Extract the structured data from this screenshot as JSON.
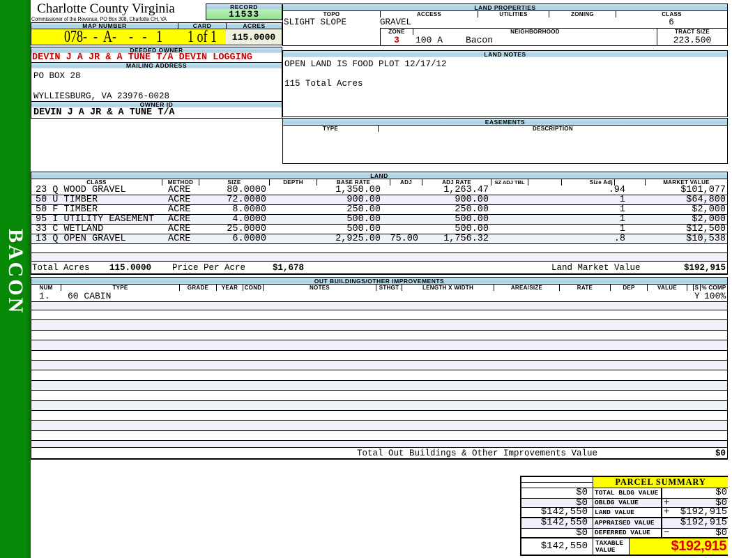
{
  "county": {
    "title": "Charlotte County Virginia",
    "subtitle": "Commissioner of the Revenue, PO Box 308, Charlotte CH, VA"
  },
  "sidebar": {
    "label": "BACON"
  },
  "record": {
    "label": "RECORD",
    "value": "11533"
  },
  "map": {
    "map_number_label": "MAP NUMBER",
    "map_number": "078-  -  A-    -   -   1",
    "card_label": "CARD",
    "card": "1 of 1",
    "acres_label": "ACRES",
    "acres": "115.0000"
  },
  "owner": {
    "deeded_owner_label": "DEEDED OWNER",
    "deeded_owner": "DEVIN J A JR & A TUNE T/A DEVIN LOGGING",
    "mailing_address_label": "MAILING ADDRESS",
    "address_line1": "PO BOX 28",
    "address_line2": "WYLLIESBURG, VA 23976-0028",
    "owner_id_label": "OWNER ID",
    "owner_id": "DEVIN J A JR & A TUNE T/A"
  },
  "land_properties": {
    "title": "LAND PROPERTIES",
    "topo_label": "TOPO",
    "access_label": "ACCESS",
    "utilities_label": "UTILITIES",
    "zoning_label": "ZONING",
    "class_label": "CLASS",
    "topo": "SLIGHT SLOPE",
    "access": "GRAVEL",
    "utilities": "",
    "zoning": "",
    "class": "6",
    "zone_label": "ZONE",
    "zone": "3",
    "neighborhood_label": "NEIGHBORHOOD",
    "neighborhood_code": "100 A",
    "neighborhood_name": "Bacon",
    "tract_size_label": "TRACT SIZE",
    "tract_size": "223.500"
  },
  "land_notes": {
    "title": "LAND NOTES",
    "line1": "OPEN LAND IS FOOD PLOT 12/17/12",
    "line2": "115 Total Acres"
  },
  "easements": {
    "title": "EASEMENTS",
    "type_label": "TYPE",
    "description_label": "DESCRIPTION"
  },
  "land": {
    "title": "LAND",
    "headers": {
      "class": "CLASS",
      "method": "METHOD",
      "size": "SIZE",
      "depth": "DEPTH",
      "base_rate": "BASE RATE",
      "adj": "ADJ",
      "adj_rate": "ADJ RATE",
      "sz_adj_tbl": "SZ ADJ TBL",
      "size_adj": "Size Adj",
      "market_value": "MARKET VALUE"
    },
    "rows": [
      {
        "class": "23 Q WOOD GRAVEL",
        "method": "ACRE",
        "size": "80.0000",
        "base_rate": "1,350.00",
        "adj": "",
        "adj_rate": "1,263.47",
        "size_adj": ".94",
        "market_value": "$101,077"
      },
      {
        "class": "50 U TIMBER",
        "method": "ACRE",
        "size": "72.0000",
        "base_rate": "900.00",
        "adj": "",
        "adj_rate": "900.00",
        "size_adj": "1",
        "market_value": "$64,800"
      },
      {
        "class": "50 F TIMBER",
        "method": "ACRE",
        "size": "8.0000",
        "base_rate": "250.00",
        "adj": "",
        "adj_rate": "250.00",
        "size_adj": "1",
        "market_value": "$2,000"
      },
      {
        "class": "95 I UTILITY EASEMENT",
        "method": "ACRE",
        "size": "4.0000",
        "base_rate": "500.00",
        "adj": "",
        "adj_rate": "500.00",
        "size_adj": "1",
        "market_value": "$2,000"
      },
      {
        "class": "33 C WETLAND",
        "method": "ACRE",
        "size": "25.0000",
        "base_rate": "500.00",
        "adj": "",
        "adj_rate": "500.00",
        "size_adj": "1",
        "market_value": "$12,500"
      },
      {
        "class": "13 Q OPEN GRAVEL",
        "method": "ACRE",
        "size": "6.0000",
        "base_rate": "2,925.00",
        "adj": "75.00",
        "adj_rate": "1,756.32",
        "size_adj": ".8",
        "market_value": "$10,538"
      }
    ],
    "totals": {
      "total_acres_label": "Total Acres",
      "total_acres": "115.0000",
      "price_per_acre_label": "Price Per Acre",
      "price_per_acre": "$1,678",
      "land_market_value_label": "Land Market Value",
      "land_market_value": "$192,915"
    }
  },
  "out_buildings": {
    "title": "OUT BUILDINGS/OTHER IMPROVEMENTS",
    "headers": {
      "num": "NUM",
      "type": "TYPE",
      "grade": "GRADE",
      "year": "YEAR",
      "cond": "COND",
      "notes": "NOTES",
      "sthgt": "STHGT",
      "length_width": "LENGTH X WIDTH",
      "area_size": "AREA/SIZE",
      "rate": "RATE",
      "dep": "DEP",
      "value": "VALUE",
      "s": "S",
      "pct_comp": "% COMP"
    },
    "row": {
      "num": "1.",
      "type": "60 CABIN",
      "s": "Y",
      "pct_comp": "100%"
    },
    "total_label": "Total Out Buildings & Other Improvements Value",
    "total_value": "$0"
  },
  "parcel_summary": {
    "title": "PARCEL SUMMARY",
    "rows": [
      {
        "left": "$0",
        "label": "TOTAL BLDG VALUE",
        "op": "",
        "right": "$0"
      },
      {
        "left": "$0",
        "label": "OBLDG VALUE",
        "op": "+",
        "right": "$0"
      },
      {
        "left": "$142,550",
        "label": "LAND VALUE",
        "op": "+",
        "right": "$192,915"
      },
      {
        "left": "$142,550",
        "label": "APPRAISED VALUE",
        "op": "",
        "right": "$192,915"
      },
      {
        "left": "$0",
        "label": "DEFERRED VALUE",
        "op": "−",
        "right": "$0"
      }
    ],
    "taxable": {
      "left": "$142,550",
      "label": "TAXABLE VALUE",
      "value": "$192,915"
    }
  }
}
